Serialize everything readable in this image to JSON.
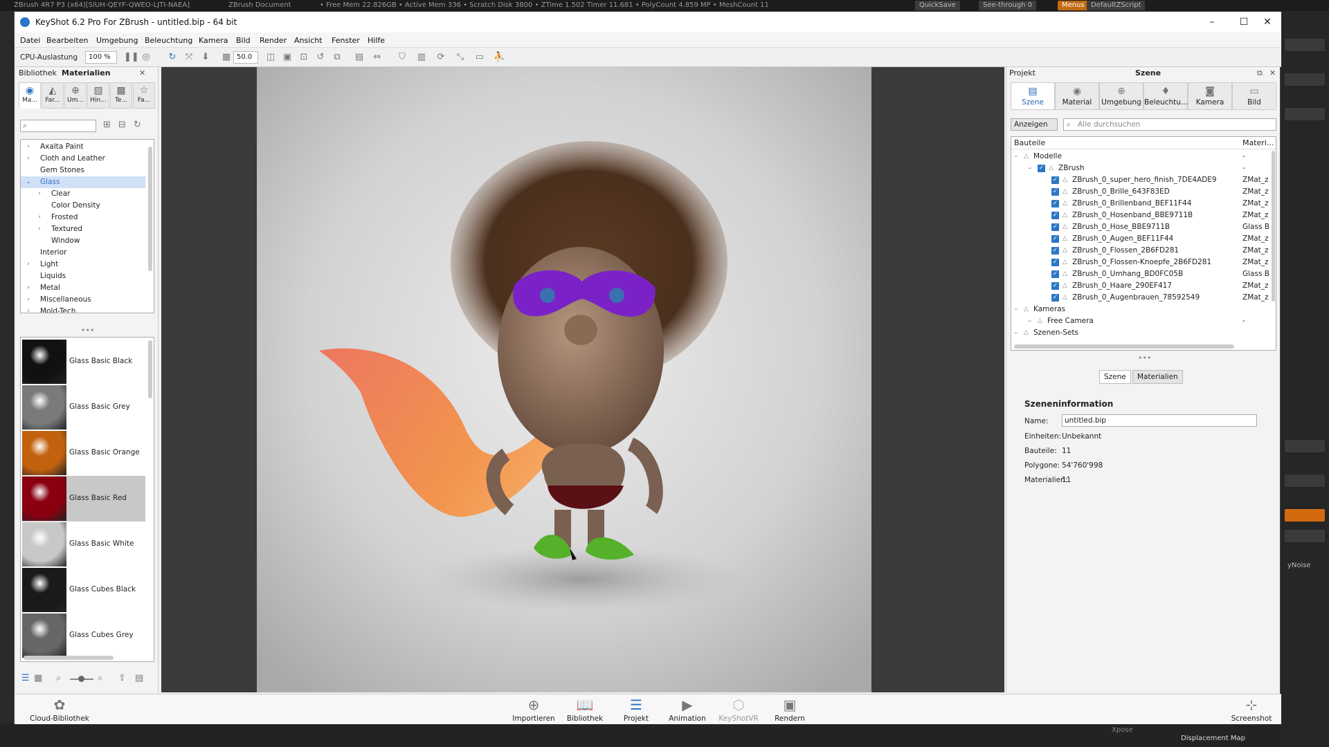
{
  "zbrush": {
    "title": "ZBrush 4R7 P3 (x64)[SIUH-QEYF-QWEO-LJTI-NAEA]",
    "doc": "ZBrush Document",
    "stats": "• Free Mem 22.826GB • Active Mem 336 • Scratch Disk 3800 • ZTime 1.502 Timer 11.681 • PolyCount 4.859 MP • MeshCount 11",
    "quicksave": "QuickSave",
    "see_through": "See-through 0",
    "menus": "Menus",
    "script": "DefaultZScript",
    "noise": "yNoise",
    "displacement": "Displacement Map",
    "xpose": "Xpose"
  },
  "window": {
    "title": "KeyShot 6.2 Pro For ZBrush - untitled.bip - 64 bit",
    "minimize": "–",
    "maximize": "☐",
    "close": "✕"
  },
  "menu": [
    "Datei",
    "Bearbeiten",
    "Umgebung",
    "Beleuchtung",
    "Kamera",
    "Bild",
    "Render",
    "Ansicht",
    "Fenster",
    "Hilfe"
  ],
  "toolbar": {
    "cpu_label": "CPU-Auslastung",
    "cpu_value": "100 %",
    "field_value": "50.0"
  },
  "library": {
    "title_a": "Bibliothek",
    "title_b": "Materialien",
    "tabs": [
      "Ma...",
      "Far...",
      "Um...",
      "Hin...",
      "Te...",
      "Fa..."
    ],
    "tree": [
      {
        "label": "Axalta Paint",
        "level": 0,
        "arrow": "›"
      },
      {
        "label": "Cloth and Leather",
        "level": 0,
        "arrow": "›"
      },
      {
        "label": "Gem Stones",
        "level": 0,
        "arrow": ""
      },
      {
        "label": "Glass",
        "level": 0,
        "arrow": "⌄"
      },
      {
        "label": "Clear",
        "level": 1,
        "arrow": "›"
      },
      {
        "label": "Color Density",
        "level": 1,
        "arrow": ""
      },
      {
        "label": "Frosted",
        "level": 1,
        "arrow": "›"
      },
      {
        "label": "Textured",
        "level": 1,
        "arrow": "›"
      },
      {
        "label": "Window",
        "level": 1,
        "arrow": ""
      },
      {
        "label": "Interior",
        "level": 0,
        "arrow": ""
      },
      {
        "label": "Light",
        "level": 0,
        "arrow": "›"
      },
      {
        "label": "Liquids",
        "level": 0,
        "arrow": ""
      },
      {
        "label": "Metal",
        "level": 0,
        "arrow": "›"
      },
      {
        "label": "Miscellaneous",
        "level": 0,
        "arrow": "›"
      },
      {
        "label": "Mold-Tech",
        "level": 0,
        "arrow": "›"
      }
    ],
    "materials": [
      {
        "label": "Glass Basic Black",
        "color": "#111111"
      },
      {
        "label": "Glass Basic Grey",
        "color": "#7a7a7a"
      },
      {
        "label": "Glass Basic Orange",
        "color": "#c2620f"
      },
      {
        "label": "Glass Basic Red",
        "color": "#8a0010"
      },
      {
        "label": "Glass Basic White",
        "color": "#c8c8c8"
      },
      {
        "label": "Glass Cubes Black",
        "color": "#1a1a1a"
      },
      {
        "label": "Glass Cubes Grey",
        "color": "#666666"
      }
    ]
  },
  "project": {
    "title_a": "Projekt",
    "title_b": "Szene",
    "tabs": [
      "Szene",
      "Material",
      "Umgebung",
      "Beleuchtu...",
      "Kamera",
      "Bild"
    ],
    "show_label": "Anzeigen",
    "search_placeholder": "Alle durchsuchen",
    "col_parts": "Bauteile",
    "col_material": "Materi...",
    "tree": [
      {
        "label": "Modelle",
        "indent": 0,
        "mat": "-",
        "check": false,
        "icon": true
      },
      {
        "label": "ZBrush",
        "indent": 1,
        "mat": "-",
        "check": true,
        "icon": true
      },
      {
        "label": "ZBrush_0_super_hero_finish_7DE4ADE9",
        "indent": 2,
        "mat": "ZMat_z",
        "check": true,
        "icon": true
      },
      {
        "label": "ZBrush_0_Brille_643F83ED",
        "indent": 2,
        "mat": "ZMat_z",
        "check": true,
        "icon": true
      },
      {
        "label": "ZBrush_0_Brillenband_BEF11F44",
        "indent": 2,
        "mat": "ZMat_z",
        "check": true,
        "icon": true
      },
      {
        "label": "ZBrush_0_Hosenband_BBE9711B",
        "indent": 2,
        "mat": "ZMat_z",
        "check": true,
        "icon": true
      },
      {
        "label": "ZBrush_0_Hose_BBE9711B",
        "indent": 2,
        "mat": "Glass B",
        "check": true,
        "icon": true
      },
      {
        "label": "ZBrush_0_Augen_BEF11F44",
        "indent": 2,
        "mat": "ZMat_z",
        "check": true,
        "icon": true
      },
      {
        "label": "ZBrush_0_Flossen_2B6FD281",
        "indent": 2,
        "mat": "ZMat_z",
        "check": true,
        "icon": true
      },
      {
        "label": "ZBrush_0_Flossen-Knoepfe_2B6FD281",
        "indent": 2,
        "mat": "ZMat_z",
        "check": true,
        "icon": true
      },
      {
        "label": "ZBrush_0_Umhang_BD0FC05B",
        "indent": 2,
        "mat": "Glass B",
        "check": true,
        "icon": true
      },
      {
        "label": "ZBrush_0_Haare_290EF417",
        "indent": 2,
        "mat": "ZMat_z",
        "check": true,
        "icon": true
      },
      {
        "label": "ZBrush_0_Augenbrauen_78592549",
        "indent": 2,
        "mat": "ZMat_z",
        "check": true,
        "icon": true
      },
      {
        "label": "Kameras",
        "indent": 0,
        "mat": "",
        "check": false,
        "icon": true
      },
      {
        "label": "Free Camera",
        "indent": 1,
        "mat": "-",
        "check": false,
        "icon": true
      },
      {
        "label": "Szenen-Sets",
        "indent": 0,
        "mat": "",
        "check": false,
        "icon": true
      }
    ],
    "subtabs": [
      "Szene",
      "Materialien"
    ],
    "info_title": "Szeneninformation",
    "info": {
      "name_label": "Name:",
      "name_value": "untitled.bip",
      "units_label": "Einheiten:",
      "units_value": "Unbekannt",
      "parts_label": "Bauteile:",
      "parts_value": "11",
      "poly_label": "Polygone:",
      "poly_value": "54'760'998",
      "mat_label": "Materialien:",
      "mat_value": "11"
    }
  },
  "bottom": {
    "cloud": "Cloud-Bibliothek",
    "buttons": [
      "Importieren",
      "Bibliothek",
      "Projekt",
      "Animation",
      "KeyShotVR",
      "Rendern"
    ],
    "screenshot": "Screenshot"
  }
}
